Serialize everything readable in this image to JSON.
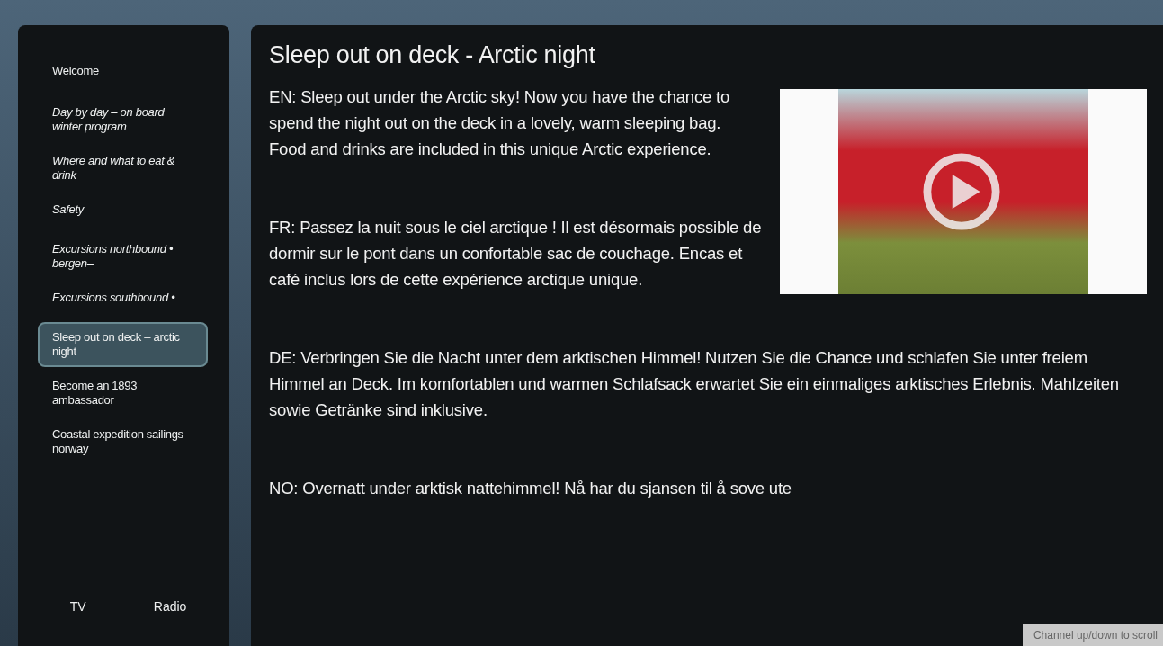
{
  "sidebar": {
    "items": [
      {
        "label": "Welcome",
        "kind": "plain",
        "selected": false
      },
      {
        "label": "Day by day – on board winter program",
        "kind": "italic",
        "selected": false
      },
      {
        "label": "Where and what to eat & drink",
        "kind": "italic",
        "selected": false
      },
      {
        "label": "Safety",
        "kind": "italic",
        "selected": false
      },
      {
        "label": "Excursions northbound • bergen–",
        "kind": "italic",
        "selected": false
      },
      {
        "label": "Excursions southbound •",
        "kind": "italic",
        "selected": false
      },
      {
        "label": "Sleep out on deck – arctic night",
        "kind": "plain",
        "selected": true
      },
      {
        "label": "Become an 1893 ambassador",
        "kind": "plain",
        "selected": false
      },
      {
        "label": "Coastal expedition sailings – norway",
        "kind": "plain",
        "selected": false
      }
    ],
    "footer_buttons": [
      "TV",
      "Radio"
    ]
  },
  "article": {
    "title": "Sleep out on deck - Arctic night",
    "paragraphs": [
      "EN: Sleep out under the Arctic sky! Now you have the chance to spend the night out on the deck in a lovely, warm sleeping bag. Food and drinks are included in this unique Arctic experience.",
      "FR: Passez la nuit sous le ciel arctique ! Il est désormais possible de dormir sur le pont dans un confortable sac de couchage. Encas et café inclus lors de cette expérience arctique unique.",
      "DE: Verbringen Sie die Nacht unter dem arktischen Himmel! Nutzen Sie die Chance und schlafen Sie unter freiem Himmel an Deck. Im komfortablen und warmen Schlafsack erwartet Sie ein einmaliges arktisches Erlebnis. Mahlzeiten sowie Getränke sind inklusive.",
      "NO: Overnatt under arktisk nattehimmel! Nå har du sjansen til å sove ute"
    ]
  },
  "scroll_hint": "Channel up/down to scroll"
}
